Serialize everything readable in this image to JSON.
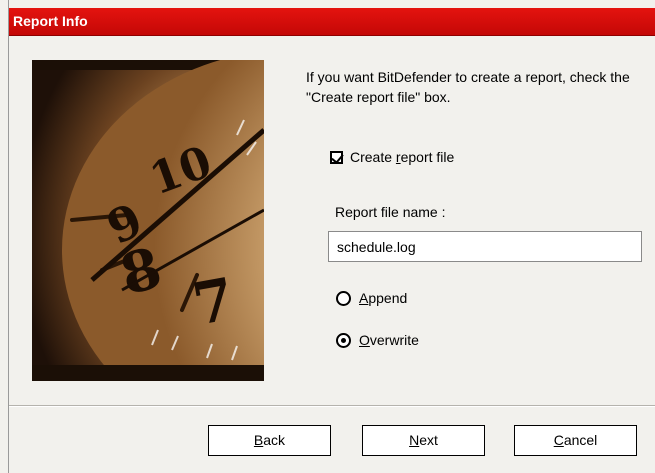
{
  "window": {
    "title": "Report Info"
  },
  "intro_text": "If you want BitDefender to create a report, check the \"Create report file\" box.",
  "options": {
    "create_report": {
      "label_pre": "Create ",
      "label_accel": "r",
      "label_post": "eport file",
      "checked": true
    },
    "report_file_label": "Report file name :",
    "report_file_value": "schedule.log",
    "mode": [
      {
        "label_accel": "A",
        "label_post": "ppend",
        "selected": false
      },
      {
        "label_accel": "O",
        "label_post": "verwrite",
        "selected": true
      }
    ]
  },
  "buttons": {
    "back": {
      "accel": "B",
      "rest": "ack"
    },
    "next": {
      "accel": "N",
      "rest": "ext"
    },
    "cancel": {
      "accel": "C",
      "rest": "ancel"
    }
  },
  "colors": {
    "titlebar": "#d50d0a",
    "title_text": "#ffffff"
  },
  "icons": {
    "photo": "clock-face-image"
  }
}
